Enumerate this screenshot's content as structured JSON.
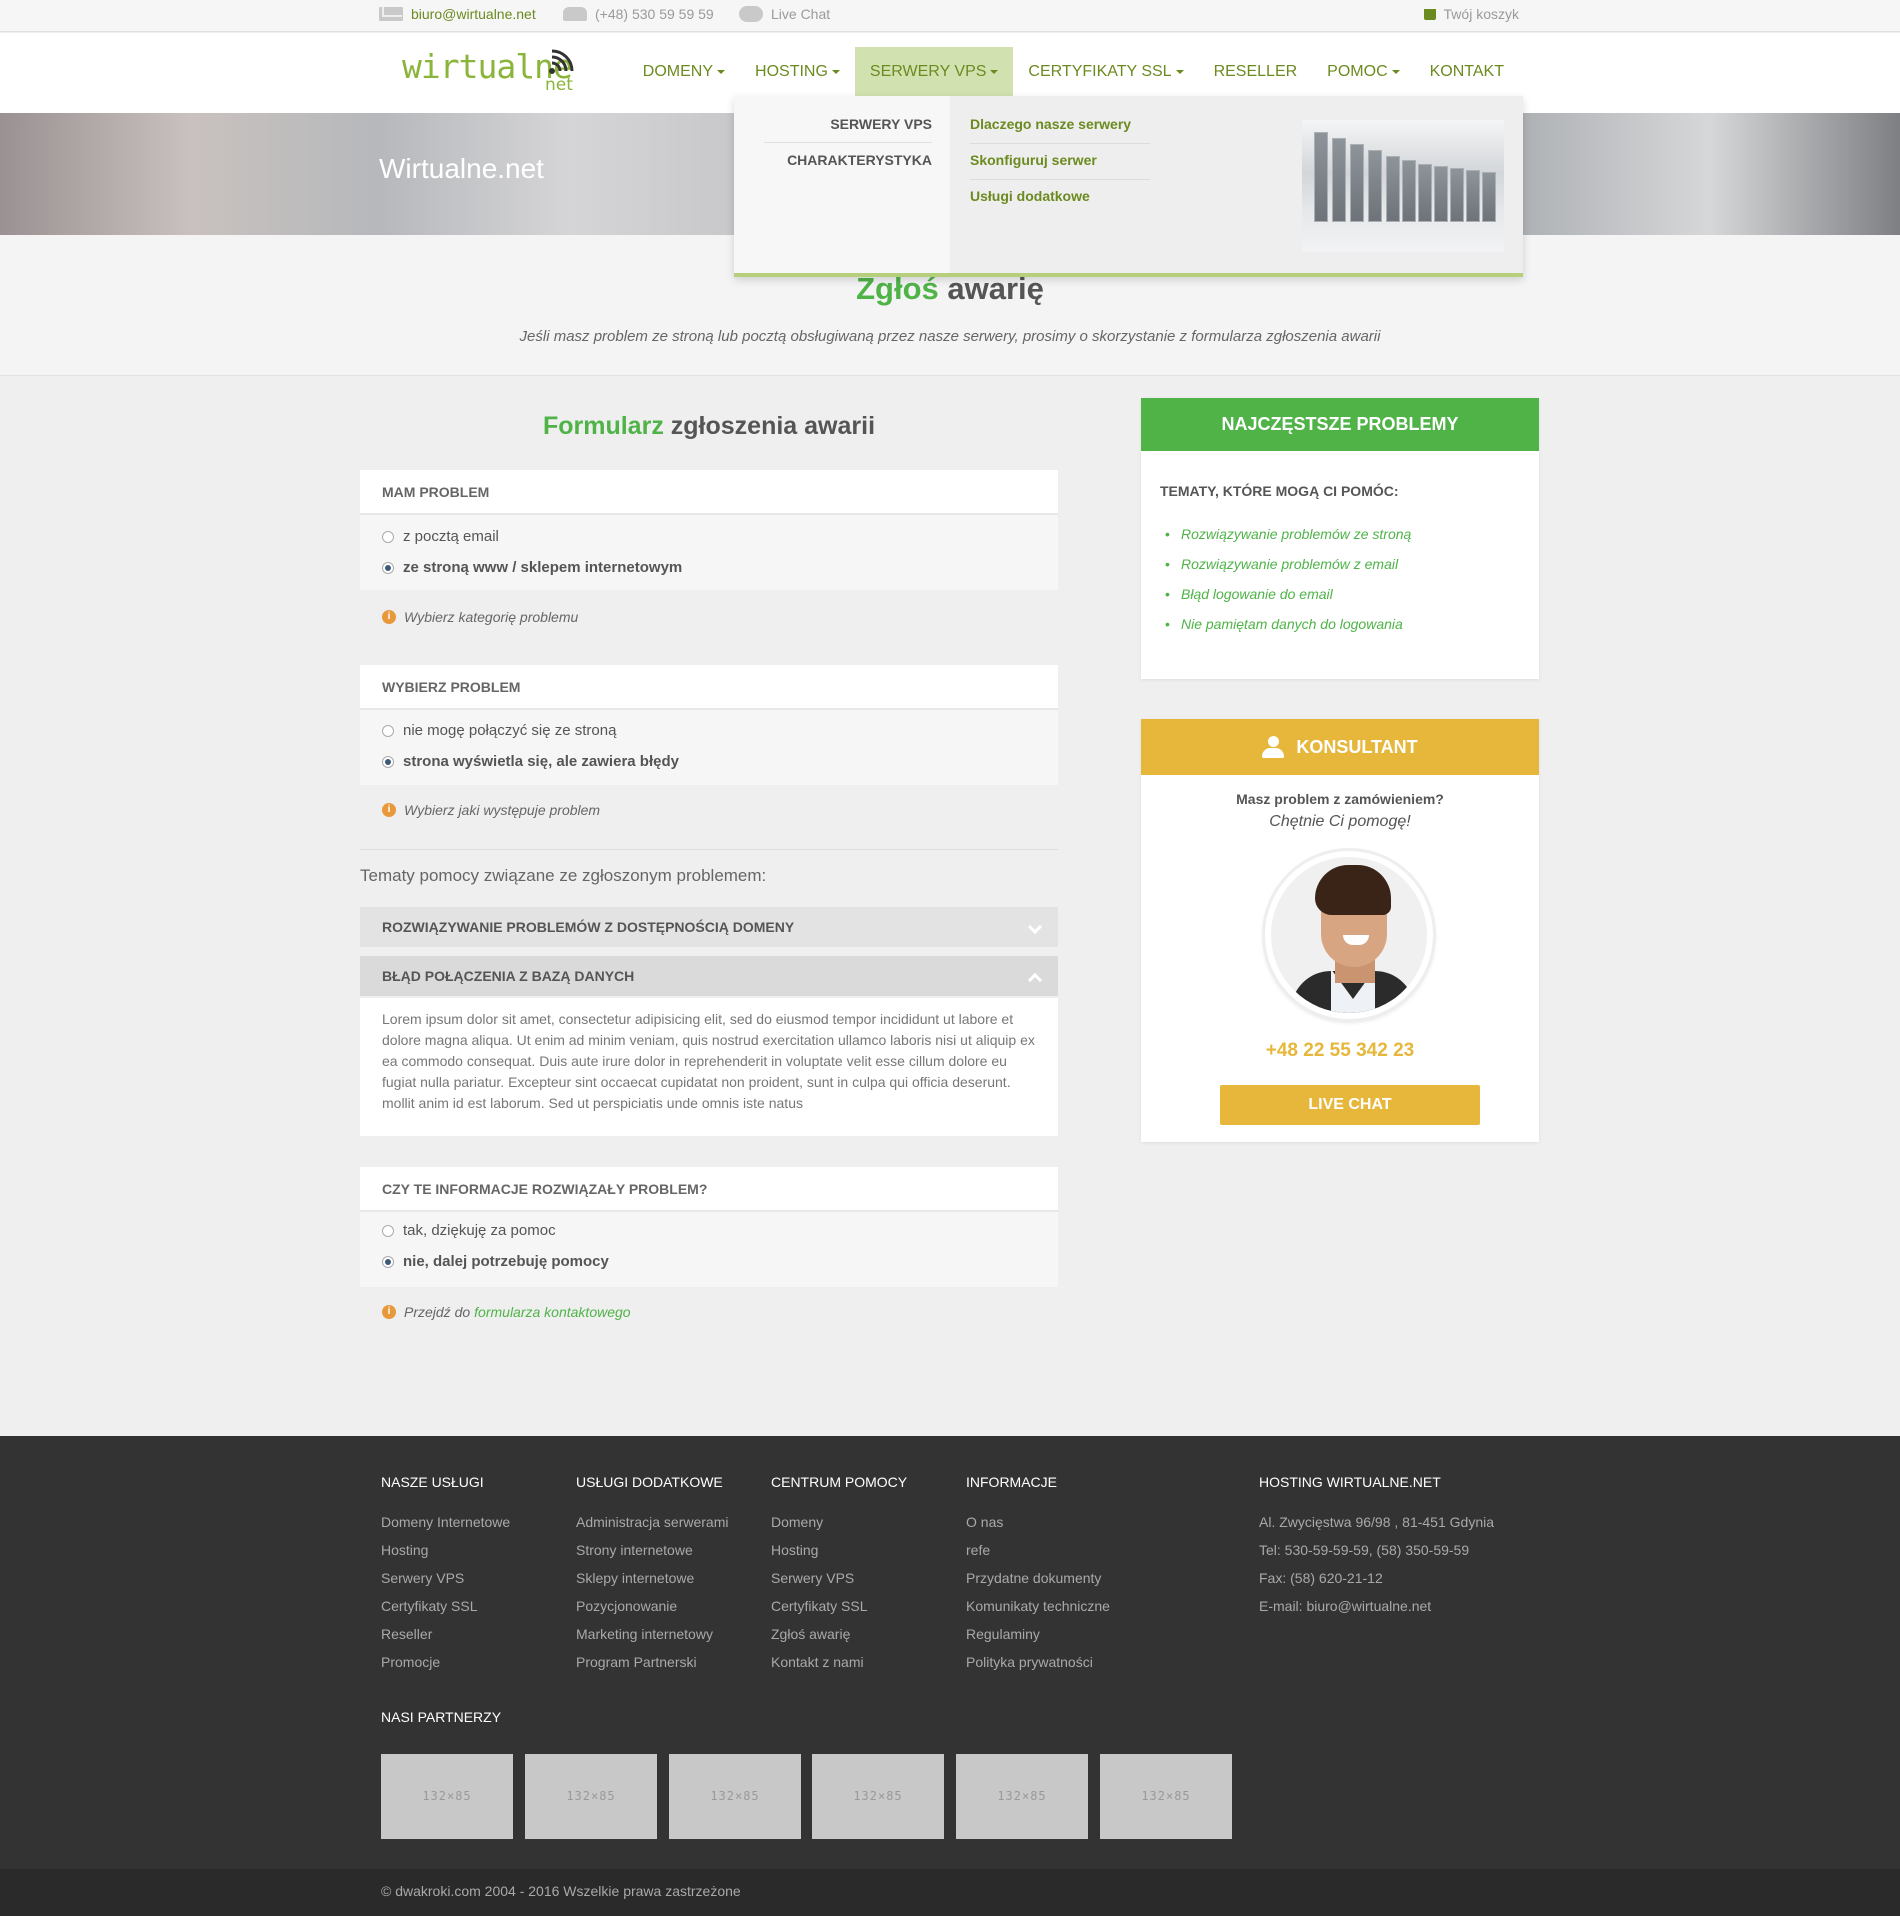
{
  "topbar": {
    "email": "biuro@wirtualne.net",
    "phone": "(+48) 530 59 59 59",
    "chat": "Live Chat",
    "cart": "Twój koszyk"
  },
  "logo": {
    "main": "wirtualne",
    "suffix": "net"
  },
  "nav": {
    "items": [
      "DOMENY",
      "HOSTING",
      "SERWERY VPS",
      "CERTYFIKATY SSL",
      "RESELLER",
      "POMOC",
      "KONTAKT"
    ]
  },
  "hero": {
    "title": "Wirtualne.net"
  },
  "mega": {
    "left": [
      "SERWERY VPS",
      "CHARAKTERYSTYKA"
    ],
    "links": [
      "Dlaczego nasze serwery",
      "Skonfiguruj serwer",
      "Usługi dodatkowe"
    ]
  },
  "intro": {
    "title_green": "Zgłoś",
    "title_rest": "awarię",
    "text": "Jeśli masz problem ze stroną lub pocztą obsługiwaną przez nasze serwery, prosimy o skorzystanie z formularza zgłoszenia awarii"
  },
  "form": {
    "title_green": "Formularz",
    "title_rest": "zgłoszenia awarii",
    "panel1": {
      "head": "MAM PROBLEM",
      "options": [
        "z pocztą email",
        "ze stroną www / sklepem internetowym"
      ],
      "hint": "Wybierz kategorię problemu"
    },
    "panel2": {
      "head": "WYBIERZ PROBLEM",
      "options": [
        "nie mogę połączyć się ze stroną",
        "strona wyświetla się, ale zawiera błędy"
      ],
      "hint": "Wybierz jaki występuje problem"
    },
    "topics_label": "Tematy pomocy związane ze zgłoszonym problemem:",
    "accordion": [
      {
        "title": "ROZWIĄZYWANIE PROBLEMÓW Z DOSTĘPNOŚCIĄ DOMENY"
      },
      {
        "title": "BŁĄD POŁĄCZENIA Z BAZĄ DANYCH",
        "body": "Lorem ipsum dolor sit amet, consectetur adipisicing elit, sed do eiusmod tempor incididunt ut labore et dolore magna aliqua. Ut enim ad minim veniam, quis nostrud exercitation ullamco laboris nisi ut aliquip ex ea commodo consequat. Duis aute irure dolor in reprehenderit in voluptate velit esse cillum dolore eu fugiat nulla pariatur. Excepteur sint occaecat cupidatat non proident, sunt in culpa qui officia deserunt. mollit anim id est laborum. Sed ut perspiciatis unde omnis iste natus"
      }
    ],
    "panel3": {
      "head": "CZY TE INFORMACJE ROZWIĄZAŁY PROBLEM?",
      "options": [
        "tak, dziękuję za pomoc",
        "nie, dalej potrzebuję pomocy"
      ],
      "hint_prefix": "Przejdź do",
      "hint_link": "formularza kontaktowego"
    }
  },
  "problems": {
    "head": "NAJCZĘSTSZE PROBLEMY",
    "sub": "TEMATY, KTÓRE MOGĄ CI POMÓC:",
    "items": [
      "Rozwiązywanie problemów ze stroną",
      "Rozwiązywanie problemów z email",
      "Błąd logowanie do email",
      "Nie pamiętam danych do logowania"
    ]
  },
  "consultant": {
    "head": "KONSULTANT",
    "question": "Masz problem z zamówieniem?",
    "tagline": "Chętnie Ci pomogę!",
    "phone": "+48 22 55 342 23",
    "button": "LIVE CHAT"
  },
  "footer": {
    "cols": [
      {
        "title": "NASZE USŁUGI",
        "links": [
          "Domeny Internetowe",
          "Hosting",
          "Serwery VPS",
          "Certyfikaty SSL",
          "Reseller",
          "Promocje"
        ]
      },
      {
        "title": "USŁUGI DODATKOWE",
        "links": [
          "Administracja serwerami",
          "Strony internetowe",
          "Sklepy internetowe",
          "Pozycjonowanie",
          "Marketing internetowy",
          "Program Partnerski"
        ]
      },
      {
        "title": "CENTRUM POMOCY",
        "links": [
          "Domeny",
          "Hosting",
          "Serwery VPS",
          "Certyfikaty SSL",
          "Zgłoś awarię",
          "Kontakt z nami"
        ]
      },
      {
        "title": "INFORMACJE",
        "links": [
          "O nas",
          "refe",
          "Przydatne dokumenty",
          "Komunikaty techniczne",
          "Regulaminy",
          "Polityka prywatności"
        ]
      },
      {
        "title": "HOSTING WIRTUALNE.NET",
        "lines": [
          "Al. Zwycięstwa 96/98 , 81-451 Gdynia",
          "Tel: 530-59-59-59, (58) 350-59-59",
          "Fax: (58) 620-21-12",
          "E-mail: biuro@wirtualne.net"
        ]
      }
    ],
    "partners_title": "NASI PARTNERZY",
    "partner_placeholder": "132×85",
    "copyright": "© dwakroki.com 2004 - 2016 Wszelkie prawa zastrzeżone"
  }
}
